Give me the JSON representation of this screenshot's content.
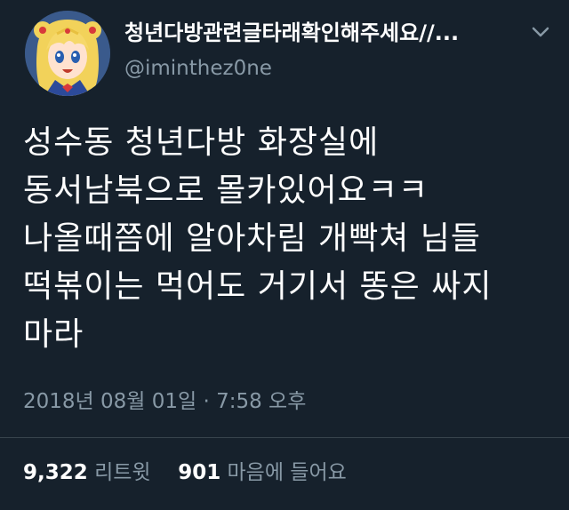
{
  "tweet": {
    "display_name": "청년다방관련글타래확인해주세요//...",
    "handle": "@iminthez0ne",
    "text_lines": [
      "성수동 청년다방 화장실에",
      "동서남북으로 몰카있어요ㅋㅋ",
      "나올때쯤에 알아차림 개빡쳐 님들",
      "떡볶이는 먹어도 거기서 똥은 싸지",
      "마라"
    ],
    "timestamp": "2018년 08월 01일 · 7:58 오후",
    "retweet_count": "9,322",
    "retweet_label": "리트윗",
    "like_count": "901",
    "like_label": "마음에 들어요"
  },
  "colors": {
    "background": "#16212c",
    "primary_text": "#ffffff",
    "secondary_text": "#8899a6",
    "divider": "#38444d"
  },
  "icons": {
    "menu": "chevron-down-icon",
    "avatar": "anime-character-avatar"
  }
}
